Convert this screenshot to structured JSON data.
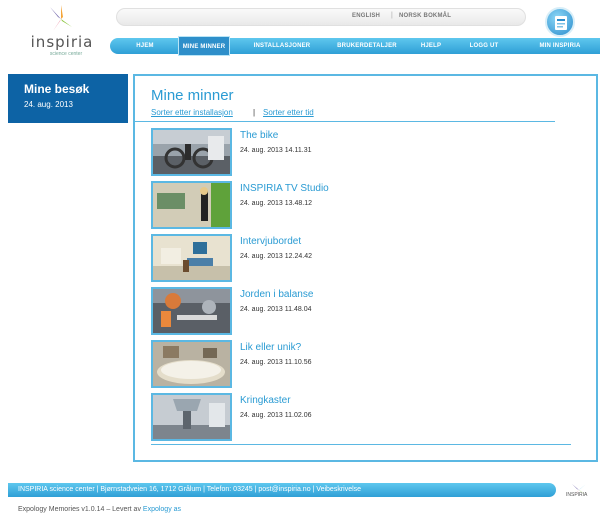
{
  "brand": {
    "logo_text": "inspiria",
    "logo_subtext": "science center"
  },
  "languages": [
    "ENGLISH",
    "NORSK BOKMÅL"
  ],
  "nav": [
    {
      "label": "HJEM"
    },
    {
      "label": "MINE MINNER",
      "active": true
    },
    {
      "label": "INSTALLASJONER"
    },
    {
      "label": "BRUKERDETALJER"
    },
    {
      "label": "HJELP"
    },
    {
      "label": "LOGG UT"
    },
    {
      "label": "MIN INSPIRIA"
    }
  ],
  "sidebar": {
    "title": "Mine besøk",
    "date": "24. aug. 2013"
  },
  "main": {
    "title": "Mine minner",
    "sort_by_installation": "Sorter etter installasjon",
    "separator": "|",
    "sort_by_time": "Sorter etter tid",
    "items": [
      {
        "title": "The bike",
        "date": "24. aug. 2013 14.11.31",
        "icon": "photo-bike"
      },
      {
        "title": "INSPIRIA TV Studio",
        "date": "24. aug. 2013 13.48.12",
        "icon": "photo-tv-studio"
      },
      {
        "title": "Intervjubordet",
        "date": "24. aug. 2013 12.24.42",
        "icon": "photo-interview"
      },
      {
        "title": "Jorden i balanse",
        "date": "24. aug. 2013 11.48.04",
        "icon": "photo-earth"
      },
      {
        "title": "Lik eller unik?",
        "date": "24. aug. 2013 11.10.56",
        "icon": "photo-lik"
      },
      {
        "title": "Kringkaster",
        "date": "24. aug. 2013 11.02.06",
        "icon": "photo-broadcast"
      }
    ]
  },
  "footer": {
    "address": "INSPIRIA science center | Bjørnstadveien 16, 1712 Grålum | Telefon: 03245 | post@inspiria.no | Veibeskrivelse",
    "logo_text": "INSPIRIA"
  },
  "credits": {
    "text": "Expology Memories v1.0.14 – Levert av",
    "link": "Expology as"
  },
  "colors": {
    "accent": "#2a9bd3",
    "nav": "#2f9fd6",
    "sidebar": "#0d63a5"
  }
}
